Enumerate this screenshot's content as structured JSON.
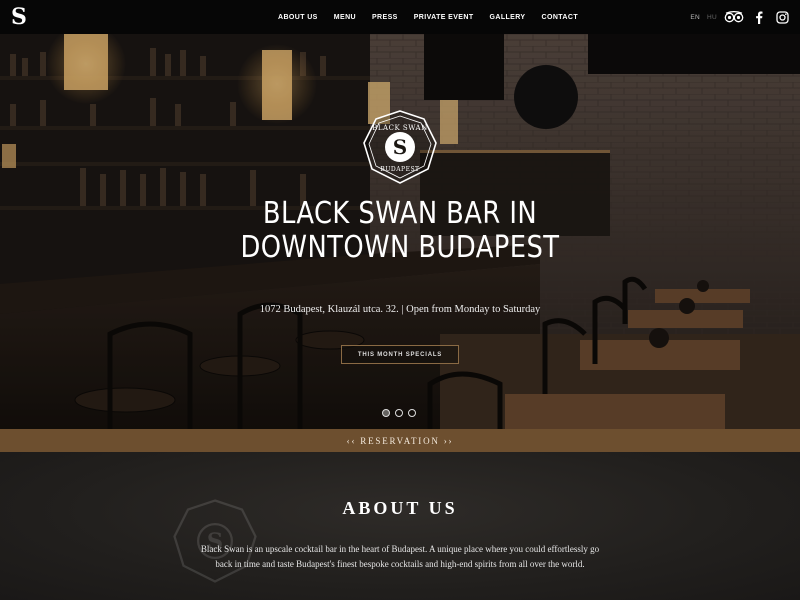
{
  "nav": {
    "logo_glyph": "S",
    "links": [
      "ABOUT US",
      "MENU",
      "PRESS",
      "PRIVATE EVENT",
      "GALLERY",
      "CONTACT"
    ],
    "lang_en": "EN",
    "lang_hu": "HU",
    "social_icons": [
      "tripadvisor-icon",
      "facebook-icon",
      "instagram-icon"
    ]
  },
  "hero": {
    "emblem_text_top": "BLACK SWAN",
    "emblem_text_bottom": "BUDAPEST",
    "emblem_glyph": "S",
    "title_line1": "BLACK SWAN BAR IN",
    "title_line2": "DOWNTOWN BUDAPEST",
    "subtitle": "1072 Budapest, Klauzál utca. 32. | Open from Monday to Saturday",
    "button_label": "THIS MONTH SPECIALS",
    "slide_count": 3,
    "active_slide": 1
  },
  "reservation": {
    "label": "‹‹ RESERVATION ››"
  },
  "about": {
    "title": "ABOUT US",
    "text": "Black Swan is an upscale cocktail bar in the heart of Budapest. A unique place where you could effortlessly go back in time and taste Budapest's finest bespoke cocktails and high-end spirits from all over the world."
  },
  "colors": {
    "nav_bg": "#060606",
    "accent_brown": "#6d4f2f",
    "button_border": "#8a6a44",
    "about_bg": "#211f1d"
  }
}
